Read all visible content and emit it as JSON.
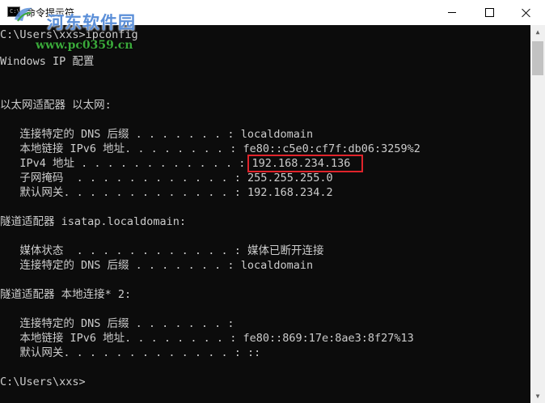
{
  "window": {
    "title": "命令提示符",
    "icon": "cmd-icon",
    "icon_text": "C:\\"
  },
  "watermark": {
    "site_name": "河东软件园",
    "url": "www.pc0359.cn"
  },
  "console": {
    "lines": [
      "C:\\Users\\xxs>ipconfig",
      "",
      "Windows IP 配置",
      "",
      "",
      "以太网适配器 以太网:",
      "",
      "   连接特定的 DNS 后缀 . . . . . . . : localdomain",
      "   本地链接 IPv6 地址. . . . . . . . : fe80::c5e0:cf7f:db06:3259%2",
      "   IPv4 地址 . . . . . . . . . . . . : 192.168.234.136",
      "   子网掩码  . . . . . . . . . . . . : 255.255.255.0",
      "   默认网关. . . . . . . . . . . . . : 192.168.234.2",
      "",
      "隧道适配器 isatap.localdomain:",
      "",
      "   媒体状态  . . . . . . . . . . . . : 媒体已断开连接",
      "   连接特定的 DNS 后缀 . . . . . . . : localdomain",
      "",
      "隧道适配器 本地连接* 2:",
      "",
      "   连接特定的 DNS 后缀 . . . . . . . :",
      "   本地链接 IPv6 地址. . . . . . . . : fe80::869:17e:8ae3:8f27%13",
      "   默认网关. . . . . . . . . . . . . : ::",
      "",
      "C:\\Users\\xxs>"
    ]
  },
  "highlight": {
    "value": "192.168.234.136",
    "color": "#e0242b"
  },
  "colors": {
    "console_bg": "#0c0c0c",
    "console_text": "#cccccc",
    "watermark_blue": "#5b8fd8",
    "watermark_green": "#3aa83a"
  }
}
